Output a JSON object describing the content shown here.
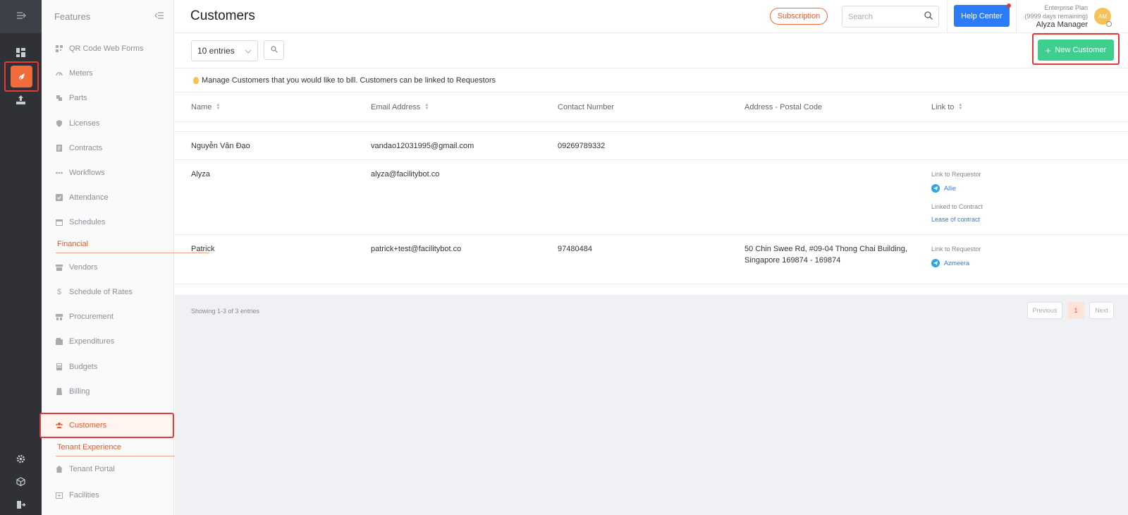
{
  "rail": {
    "icons": [
      "collapse-icon",
      "dashboard-icon",
      "features-icon",
      "reports-icon",
      "settings-icon",
      "package-icon",
      "logout-icon"
    ]
  },
  "sidebar": {
    "title": "Features",
    "items": [
      {
        "label": "QR Code Web Forms",
        "icon": "qr-icon"
      },
      {
        "label": "Meters",
        "icon": "meter-icon"
      },
      {
        "label": "Parts",
        "icon": "parts-icon"
      },
      {
        "label": "Licenses",
        "icon": "shield-icon"
      },
      {
        "label": "Contracts",
        "icon": "contract-icon"
      },
      {
        "label": "Workflows",
        "icon": "workflow-icon"
      },
      {
        "label": "Attendance",
        "icon": "check-icon"
      },
      {
        "label": "Schedules",
        "icon": "calendar-icon"
      }
    ],
    "section_financial": "Financial",
    "financial_items": [
      {
        "label": "Vendors",
        "icon": "store-icon"
      },
      {
        "label": "Schedule of Rates",
        "icon": "dollar-icon"
      },
      {
        "label": "Procurement",
        "icon": "cart-icon"
      },
      {
        "label": "Expenditures",
        "icon": "wallet-icon"
      },
      {
        "label": "Budgets",
        "icon": "calculator-icon"
      },
      {
        "label": "Billing",
        "icon": "billing-icon"
      },
      {
        "label": "Customers",
        "icon": "users-icon"
      }
    ],
    "section_tenant": "Tenant Experience",
    "tenant_items": [
      {
        "label": "Tenant Portal",
        "icon": "home-icon"
      },
      {
        "label": "Facilities",
        "icon": "facility-icon"
      }
    ]
  },
  "header": {
    "title": "Customers",
    "subscription_label": "Subscription",
    "search_placeholder": "Search",
    "help_label": "Help Center",
    "plan_name": "Enterprise Plan",
    "plan_remaining": "(9999 days remaining)",
    "user_name": "Alyza Manager",
    "avatar_initials": "AM"
  },
  "toolbar": {
    "entries_value": "10 entries",
    "new_label": "New Customer"
  },
  "info_text": "Manage Customers that you would like to bill. Customers can be linked to Requestors",
  "table": {
    "headers": {
      "name": "Name",
      "email": "Email Address",
      "contact": "Contact Number",
      "address": "Address - Postal Code",
      "link": "Link to"
    },
    "rows": [
      {
        "name": "Nguyễn Văn Đạo",
        "email": "vandao12031995@gmail.com",
        "contact": "09269789332",
        "address_line1": "",
        "address_line2": ""
      },
      {
        "name": "Alyza",
        "email": "alyza@facilitybot.co",
        "contact": "",
        "address_line1": "",
        "address_line2": "",
        "link_requestor_label": "Link to Requestor",
        "link_requestor_value": "Allie",
        "link_contract_label": "Linked to Contract",
        "link_contract_value": "Lease of contract"
      },
      {
        "name": "Patrick",
        "email": "patrick+test@facilitybot.co",
        "contact": "97480484",
        "address_line1": "50 Chin Swee Rd, #09-04 Thong Chai Building,",
        "address_line2": "Singapore 169874 - 169874",
        "link_requestor_label": "Link to Requestor",
        "link_requestor_value": "Azmeera"
      }
    ]
  },
  "pagination": {
    "showing": "Showing 1-3 of 3 entries",
    "previous": "Previous",
    "page": "1",
    "next": "Next"
  },
  "colors": {
    "accent": "#e8572a",
    "primary": "#2b7cf6",
    "success": "#3ecf8e",
    "highlight": "#e53935"
  }
}
